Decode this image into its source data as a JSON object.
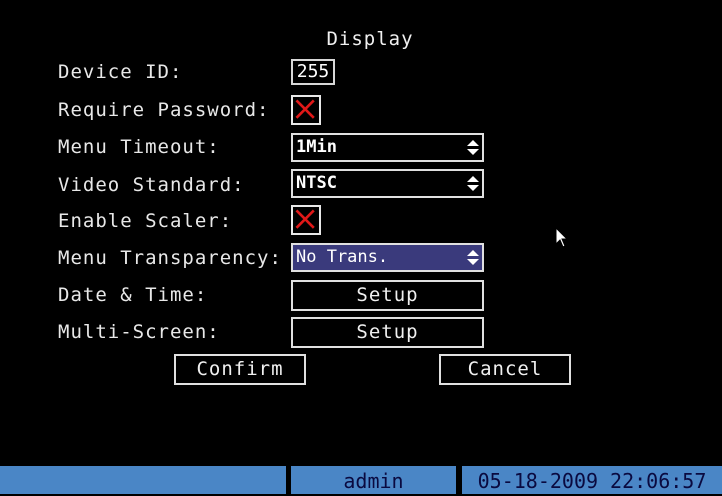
{
  "title": "Display",
  "fields": {
    "device_id": {
      "label": "Device ID:",
      "value": "255"
    },
    "require_password": {
      "label": "Require Password:",
      "checked": true
    },
    "menu_timeout": {
      "label": "Menu Timeout:",
      "value": "1Min"
    },
    "video_standard": {
      "label": "Video Standard:",
      "value": "NTSC"
    },
    "enable_scaler": {
      "label": "Enable Scaler:",
      "checked": true
    },
    "menu_transparency": {
      "label": "Menu Transparency:",
      "value": "No Trans."
    },
    "date_time": {
      "label": "Date & Time:",
      "button": "Setup"
    },
    "multi_screen": {
      "label": "Multi-Screen:",
      "button": "Setup"
    }
  },
  "actions": {
    "confirm": "Confirm",
    "cancel": "Cancel"
  },
  "status_bar": {
    "user": "admin",
    "datetime": "05-18-2009 22:06:57"
  },
  "colors": {
    "background": "#000000",
    "status_bar": "#4a86c6",
    "check_mark": "#e01818",
    "selected_field": "#3a3a7c"
  }
}
